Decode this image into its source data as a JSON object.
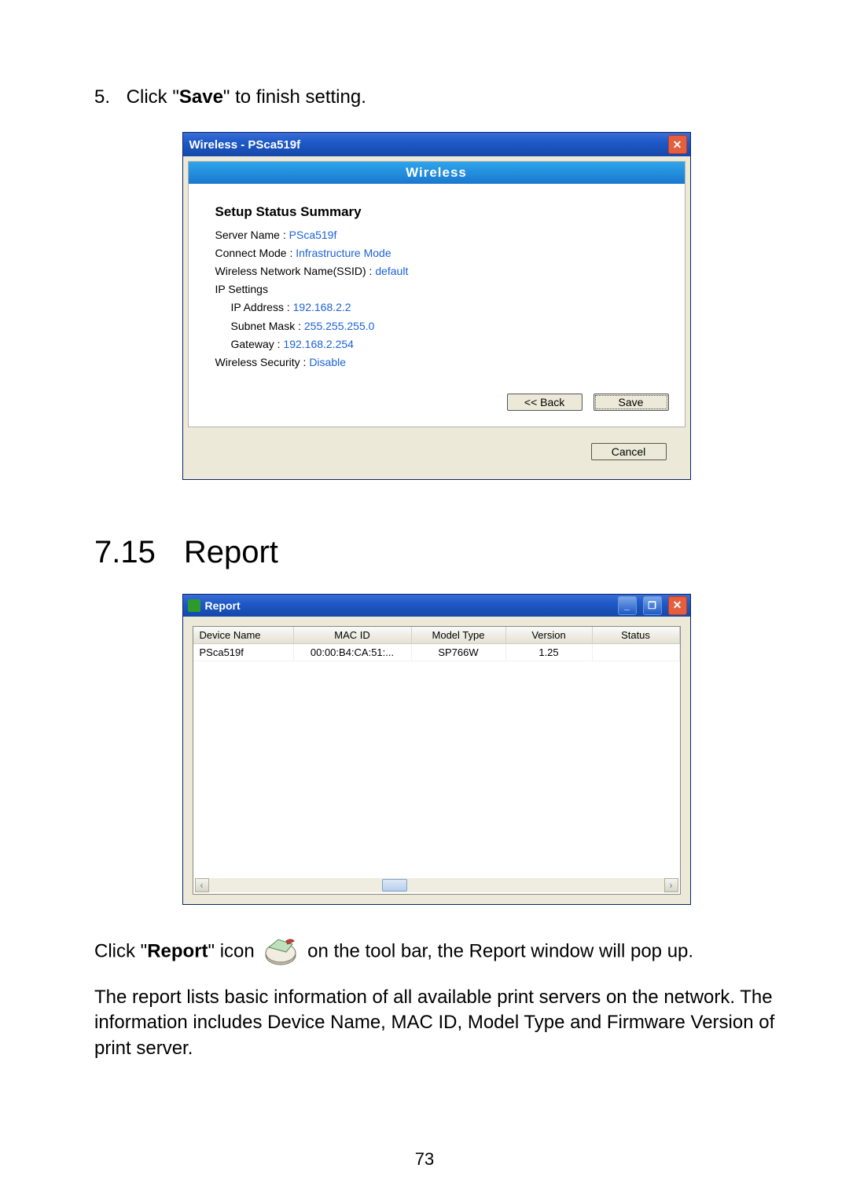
{
  "instruction": {
    "number": "5.",
    "prefix": "Click \"",
    "bold": "Save",
    "suffix": "\" to finish setting."
  },
  "wireless_dialog": {
    "title": "Wireless - PSca519f",
    "close_label": "✕",
    "panel_header": "Wireless",
    "summary_title": "Setup Status Summary",
    "server_name_k": "Server Name :",
    "server_name_v": "PSca519f",
    "connect_mode_k": "Connect Mode :",
    "connect_mode_v": "Infrastructure Mode",
    "ssid_k": "Wireless Network Name(SSID) :",
    "ssid_v": "default",
    "ip_settings_k": "IP Settings",
    "ip_addr_k": "IP Address :",
    "ip_addr_v": "192.168.2.2",
    "subnet_k": "Subnet Mask :",
    "subnet_v": "255.255.255.0",
    "gateway_k": "Gateway :",
    "gateway_v": "192.168.2.254",
    "security_k": "Wireless Security :",
    "security_v": "Disable",
    "back_label": "<< Back",
    "save_label": "Save",
    "cancel_label": "Cancel"
  },
  "section": {
    "num": "7.15",
    "title": "Report"
  },
  "report_window": {
    "title": "Report",
    "min_label": "_",
    "max_label": "❐",
    "close_label": "✕",
    "columns": {
      "device_name": "Device Name",
      "mac_id": "MAC ID",
      "model_type": "Model Type",
      "version": "Version",
      "status": "Status"
    },
    "rows": [
      {
        "device_name": "PSca519f",
        "mac_id": "00:00:B4:CA:51:...",
        "model_type": "SP766W",
        "version": "1.25",
        "status": ""
      }
    ],
    "scroll_left": "‹",
    "scroll_right": "›"
  },
  "para1": {
    "p1": "Click \"",
    "bold": "Report",
    "p2": "\" icon",
    "p3": "on the tool bar, the Report window will pop up."
  },
  "para2": "The report lists basic information of all available print servers on the network. The information includes Device Name, MAC ID, Model Type and Firmware Version of print server.",
  "page_number": "73"
}
